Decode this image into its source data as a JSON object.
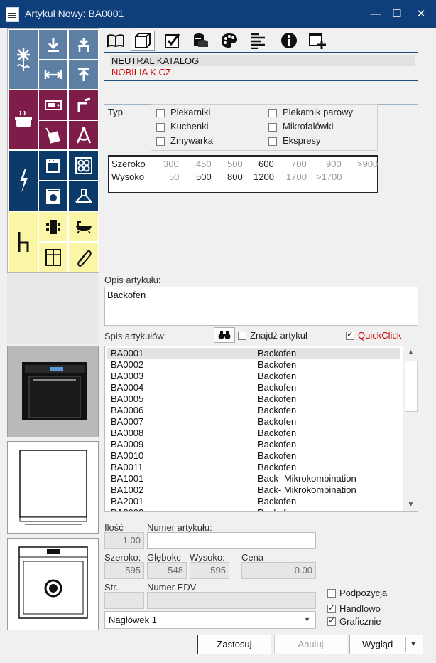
{
  "window": {
    "title": "Artykuł Nowy: BA0001",
    "minimize": "—",
    "maximize": "☐",
    "close": "✕"
  },
  "palette": {
    "tiles": [
      "flower-icon",
      "download-arrow-icon",
      "install-arrow-icon",
      "width-arrows-icon",
      "upload-arrow-icon",
      "cooking-pot-icon",
      "panel-icon",
      "faucet-icon",
      "bag-icon",
      "compass-icon",
      "lightning-icon",
      "oven-icon",
      "cooktop-icon",
      "washing-machine-icon",
      "hood-icon",
      "chair-icon",
      "dining-table-icon",
      "bathtub-icon",
      "cabinet-icon",
      "paperclip-icon"
    ]
  },
  "toolbar": {
    "icons": [
      "book-icon",
      "box-icon",
      "checkbox-icon",
      "database-icon",
      "palette-icon",
      "align-icon",
      "info-icon",
      "add-window-icon"
    ]
  },
  "catalog": {
    "line1": "NEUTRAL KATALOG",
    "line2": "NOBILIA K CZ",
    "line2_color": "#cc0000"
  },
  "typ": {
    "label": "Typ",
    "options": [
      {
        "label": "Piekarniki",
        "checked": false
      },
      {
        "label": "Piekarnik parowy",
        "checked": false
      },
      {
        "label": "Kuchenki",
        "checked": false
      },
      {
        "label": "Mikrofalówki",
        "checked": false
      },
      {
        "label": "Zmywarka",
        "checked": false
      },
      {
        "label": "Ekspresy",
        "checked": false
      }
    ]
  },
  "sizes": {
    "szeroko_label": "Szeroko",
    "szeroko": [
      {
        "v": "300",
        "on": false
      },
      {
        "v": "450",
        "on": false
      },
      {
        "v": "500",
        "on": false
      },
      {
        "v": "600",
        "on": true
      },
      {
        "v": "700",
        "on": false
      },
      {
        "v": "900",
        "on": false
      },
      {
        "v": ">900",
        "on": false
      }
    ],
    "wysoko_label": "Wysoko",
    "wysoko": [
      {
        "v": "50",
        "on": false
      },
      {
        "v": "500",
        "on": true
      },
      {
        "v": "800",
        "on": true
      },
      {
        "v": "1200",
        "on": true
      },
      {
        "v": "1700",
        "on": false
      },
      {
        "v": ">1700",
        "on": false
      }
    ]
  },
  "opis": {
    "label": "Opis artykułu:",
    "value": "Backofen"
  },
  "spis": {
    "label": "Spis artykułów:",
    "find_label": "Znajdź artykuł",
    "quickclick_label": "QuickClick",
    "quickclick_checked": true,
    "items": [
      [
        "BA0001",
        "Backofen"
      ],
      [
        "BA0002",
        "Backofen"
      ],
      [
        "BA0003",
        "Backofen"
      ],
      [
        "BA0004",
        "Backofen"
      ],
      [
        "BA0005",
        "Backofen"
      ],
      [
        "BA0006",
        "Backofen"
      ],
      [
        "BA0007",
        "Backofen"
      ],
      [
        "BA0008",
        "Backofen"
      ],
      [
        "BA0009",
        "Backofen"
      ],
      [
        "BA0010",
        "Backofen"
      ],
      [
        "BA0011",
        "Backofen"
      ],
      [
        "BA1001",
        "Back- Mikrokombination"
      ],
      [
        "BA1002",
        "Back- Mikrokombination"
      ],
      [
        "BA2001",
        "Backofen"
      ],
      [
        "BA2002",
        "Backofen"
      ]
    ]
  },
  "form": {
    "ilosc_label": "Ilość",
    "ilosc": "1.00",
    "numer_label": "Numer artykułu:",
    "numer": "",
    "szerokosc_label": "Szeroko:",
    "szerokosc": "595",
    "glebokosc_label": "Głębokc",
    "glebokosc": "548",
    "wysokosc_label": "Wysoko:",
    "wysokosc": "595",
    "cena_label": "Cena",
    "cena": "0.00",
    "str_label": "Str.",
    "str": "",
    "edv_label": "Numer EDV",
    "edv": "",
    "naglowek": "Nagłówek 1",
    "podpozycja_label": "Podpozycja",
    "podpozycja": false,
    "handlowo_label": "Handlowo",
    "handlowo": true,
    "graficznie_label": "Graficznie",
    "graficznie": true
  },
  "buttons": {
    "apply": "Zastosuj",
    "cancel": "Anuluj",
    "view": "Wygląd"
  }
}
